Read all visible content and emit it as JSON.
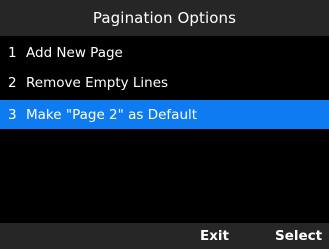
{
  "header": {
    "title": "Pagination Options"
  },
  "menu": {
    "items": [
      {
        "number": "1",
        "label": "Add New Page",
        "selected": false
      },
      {
        "number": "2",
        "label": "Remove Empty Lines",
        "selected": false
      },
      {
        "number": "3",
        "label": "Make \"Page 2\" as Default",
        "selected": true
      }
    ]
  },
  "softkeys": {
    "left": "",
    "center": "Exit",
    "right": "Select"
  },
  "colors": {
    "background": "#000000",
    "bar_background": "#262626",
    "selection": "#0f7bf0",
    "text": "#ffffff"
  }
}
